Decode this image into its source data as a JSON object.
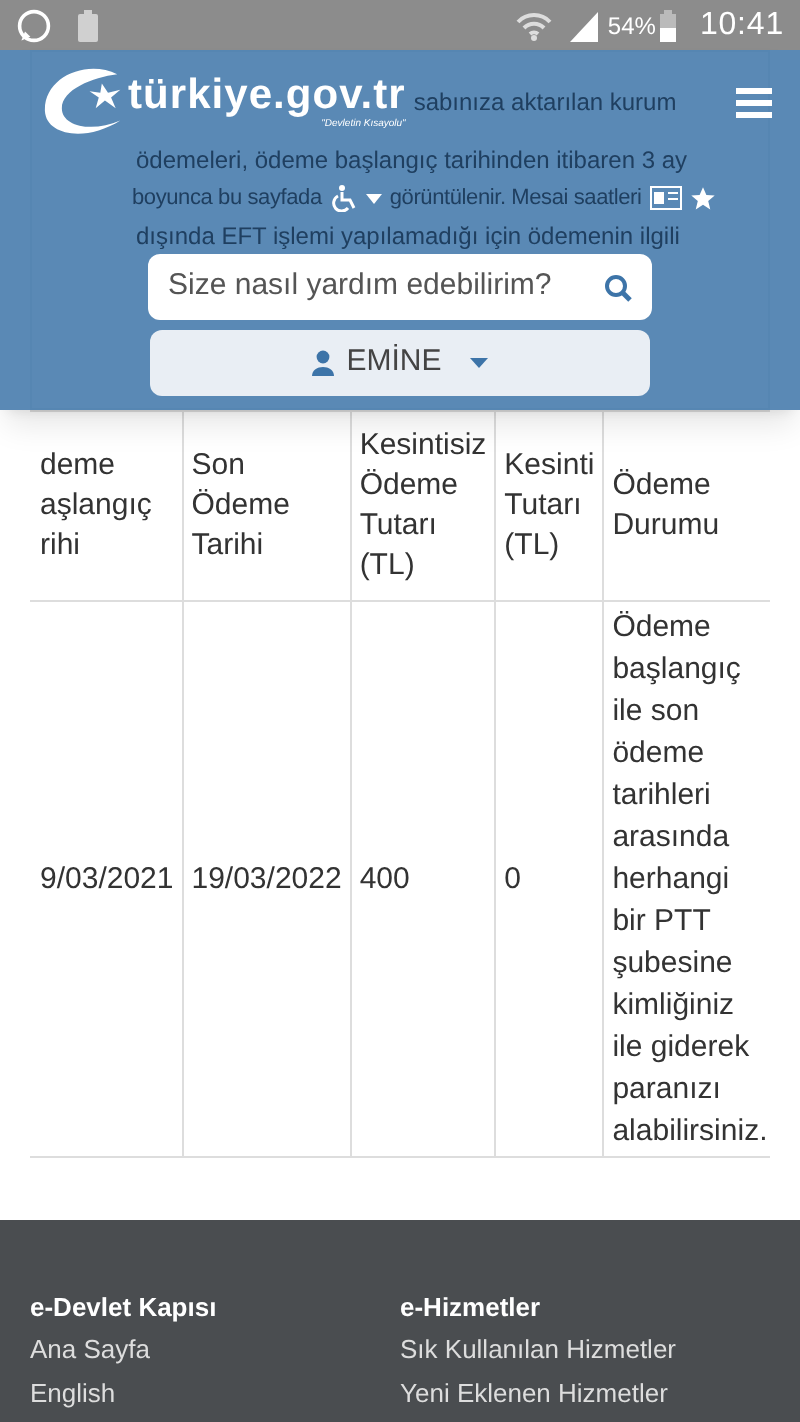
{
  "status_bar": {
    "battery_percent": "54%",
    "time": "10:41"
  },
  "notice_lines": [
    "sabınıza aktarılan kurum",
    "ödemeleri, ödeme başlangıç tarihinden itibaren 3 ay",
    "boyunca bu sayfada görüntülenir. Mesai saatleri",
    "dışında EFT işlemi yapılamadığı için ödemenin ilgili"
  ],
  "header": {
    "logo_text": "türkiye.gov.tr",
    "logo_tagline": "\"Devletin Kısayolu\"",
    "search": {
      "placeholder": "Size nasıl yardım edebilirim?"
    },
    "user_button": "EMİNE"
  },
  "table": {
    "columns": [
      "deme\naşlangıç\nrihi",
      "Son\nÖdeme\nTarihi",
      "Kesintisiz\nÖdeme\nTutarı\n(TL)",
      "Kesinti\nTutarı\n(TL)",
      "Ödeme\nDurumu"
    ],
    "rows": [
      [
        "9/03/2021",
        "19/03/2022",
        "400",
        "0",
        "Ödeme başlangıç ile son ödeme tarihleri arasında herhangi bir PTT şubesine kimliğiniz ile giderek paranızı alabilirsiniz."
      ]
    ]
  },
  "footer": {
    "columns": [
      {
        "title": "e-Devlet Kapısı",
        "links": [
          "Ana Sayfa",
          "English"
        ]
      },
      {
        "title": "e-Hizmetler",
        "links": [
          "Sık Kullanılan Hizmetler",
          "Yeni Eklenen Hizmetler"
        ]
      }
    ]
  }
}
